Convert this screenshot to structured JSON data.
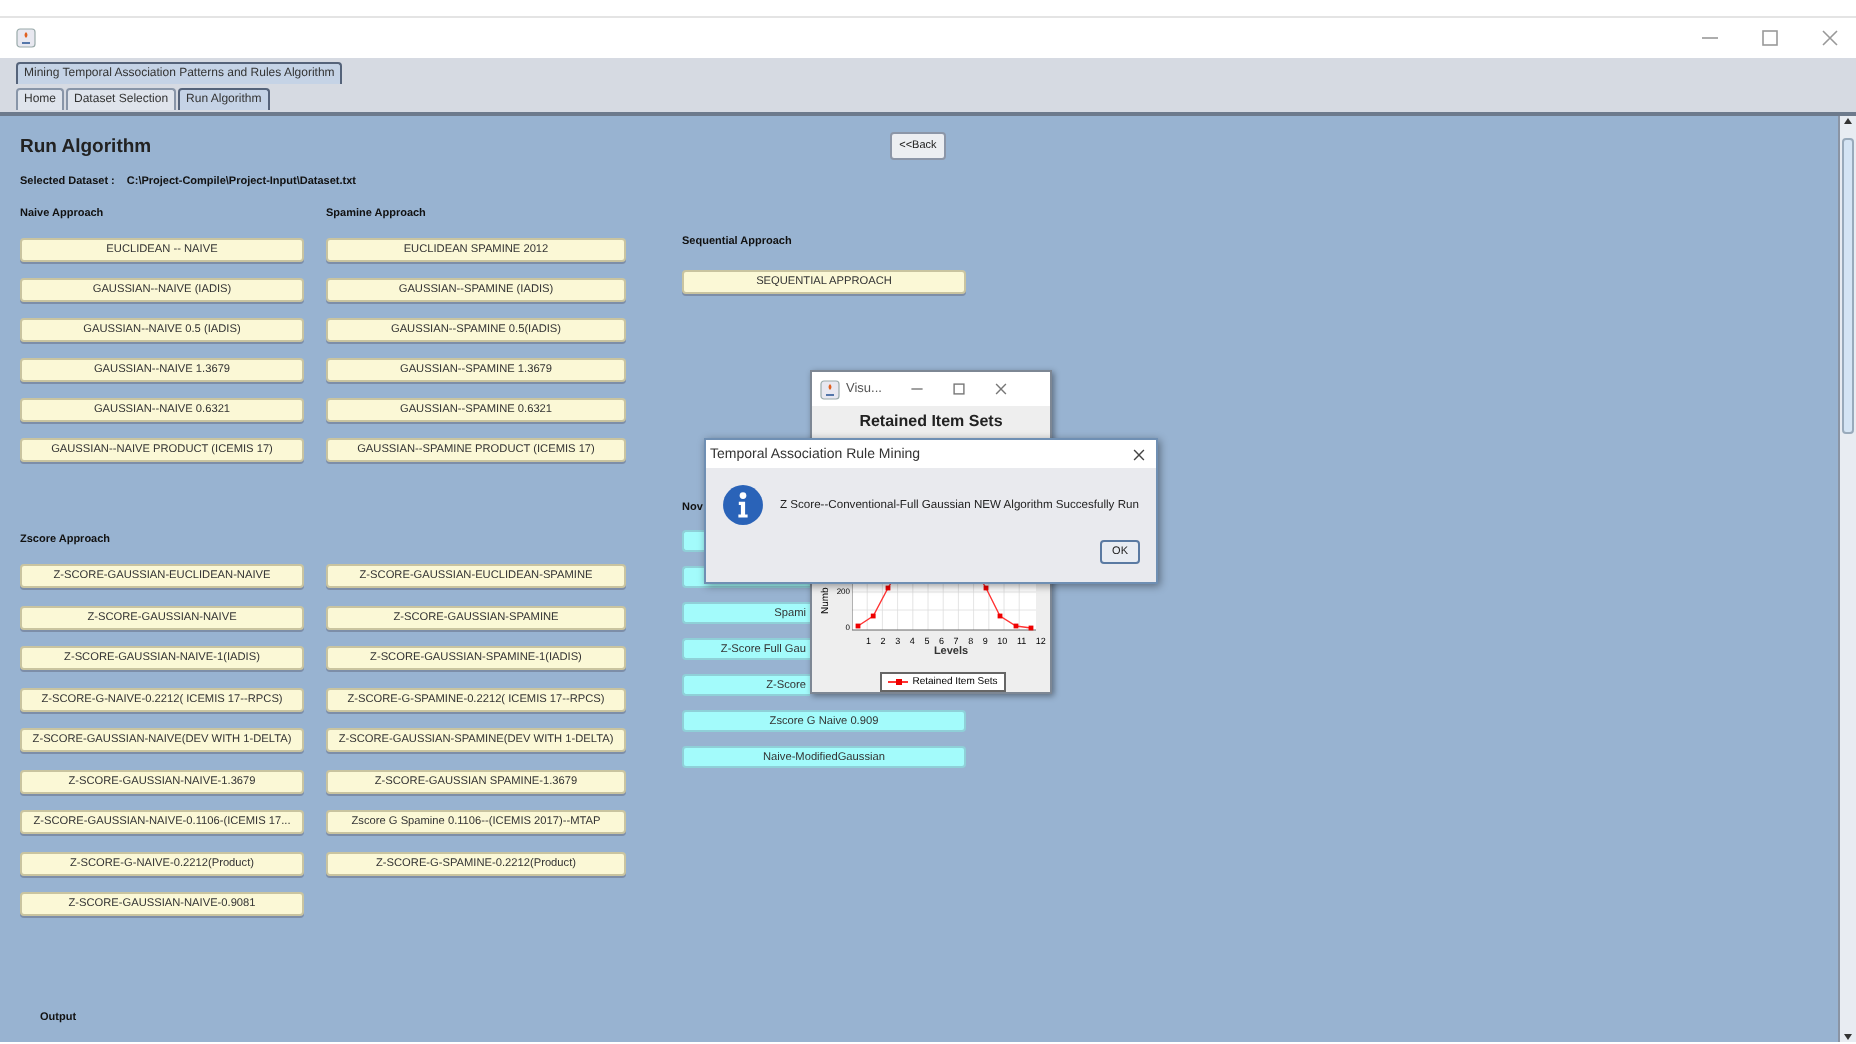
{
  "app_tab": {
    "label": "Mining Temporal Association Patterns and Rules Algorithm",
    "selected": true
  },
  "tabs": [
    {
      "label": "Home",
      "selected": false
    },
    {
      "label": "Dataset Selection",
      "selected": false
    },
    {
      "label": "Run Algorithm",
      "selected": true
    }
  ],
  "page": {
    "title": "Run Algorithm",
    "back_button": "<<Back",
    "dataset_label": "Selected Dataset :",
    "dataset_path": "C:\\Project-Compile\\Project-Input\\Dataset.txt"
  },
  "naive": {
    "heading": "Naive Approach",
    "buttons": [
      "EUCLIDEAN -- NAIVE",
      "GAUSSIAN--NAIVE (IADIS)",
      "GAUSSIAN--NAIVE 0.5 (IADIS)",
      "GAUSSIAN--NAIVE 1.3679",
      "GAUSSIAN--NAIVE 0.6321",
      "GAUSSIAN--NAIVE PRODUCT (ICEMIS 17)"
    ]
  },
  "spamine": {
    "heading": "Spamine Approach",
    "buttons": [
      "EUCLIDEAN SPAMINE 2012",
      "GAUSSIAN--SPAMINE (IADIS)",
      "GAUSSIAN--SPAMINE 0.5(IADIS)",
      "GAUSSIAN--SPAMINE 1.3679",
      "GAUSSIAN--SPAMINE 0.6321",
      "GAUSSIAN--SPAMINE PRODUCT (ICEMIS 17)"
    ]
  },
  "zscore": {
    "heading": "Zscore Approach",
    "left_buttons": [
      "Z-SCORE-GAUSSIAN-EUCLIDEAN-NAIVE",
      "Z-SCORE-GAUSSIAN-NAIVE",
      "Z-SCORE-GAUSSIAN-NAIVE-1(IADIS)",
      "Z-SCORE-G-NAIVE-0.2212( ICEMIS 17--RPCS)",
      "Z-SCORE-GAUSSIAN-NAIVE(DEV WITH 1-DELTA)",
      "Z-SCORE-GAUSSIAN-NAIVE-1.3679",
      "Z-SCORE-GAUSSIAN-NAIVE-0.1106-(ICEMIS 17...",
      "Z-SCORE-G-NAIVE-0.2212(Product)",
      "Z-SCORE-GAUSSIAN-NAIVE-0.9081"
    ],
    "right_buttons": [
      "Z-SCORE-GAUSSIAN-EUCLIDEAN-SPAMINE",
      "Z-SCORE-GAUSSIAN-SPAMINE",
      "Z-SCORE-GAUSSIAN-SPAMINE-1(IADIS)",
      "Z-SCORE-G-SPAMINE-0.2212( ICEMIS 17--RPCS)",
      "Z-SCORE-GAUSSIAN-SPAMINE(DEV WITH 1-DELTA)",
      "Z-SCORE-GAUSSIAN SPAMINE-1.3679",
      "Zscore G Spamine 0.1106--(ICEMIS 2017)--MTAP",
      "Z-SCORE-G-SPAMINE-0.2212(Product)"
    ]
  },
  "sequential": {
    "heading": "Sequential Approach",
    "buttons": [
      "SEQUENTIAL APPROACH"
    ]
  },
  "novel": {
    "heading": "Nov",
    "buttons": [
      {
        "kind": "covered"
      },
      {
        "kind": "covered"
      },
      {
        "kind": "cut",
        "label": "Spami"
      },
      {
        "kind": "cut",
        "label": "Z-Score Full Gau"
      },
      {
        "kind": "cut",
        "label": "Z-Score"
      },
      {
        "kind": "full",
        "label": "Zscore G Naive 0.909"
      },
      {
        "kind": "full",
        "label": "Naive-ModifiedGaussian"
      }
    ]
  },
  "output": {
    "heading": "Output"
  },
  "chart_window": {
    "title": "Visu...",
    "chart_title": "Retained Item Sets",
    "y_label": "Numb",
    "y_ticks": [
      "200",
      "0"
    ],
    "x_ticks": [
      "1",
      "2",
      "3",
      "4",
      "5",
      "6",
      "7",
      "8",
      "9",
      "10",
      "11",
      "12"
    ],
    "x_label": "Levels",
    "legend": "Retained Item Sets"
  },
  "dialog": {
    "title": "Temporal Association Rule Mining",
    "message": "Z Score--Conventional-Full Gaussian NEW Algorithm Succesfully Run",
    "ok_button": "OK"
  }
}
